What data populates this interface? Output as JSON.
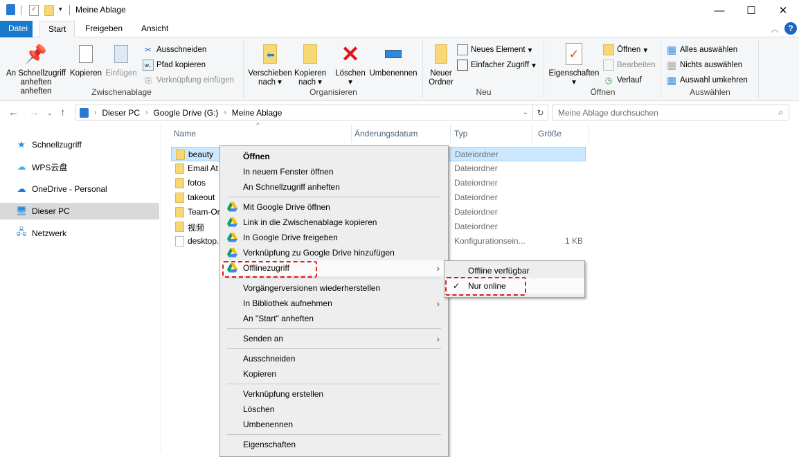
{
  "window": {
    "title": "Meine Ablage",
    "minimize": "—",
    "maximize": "☐",
    "close": "✕"
  },
  "tabs": [
    {
      "label": "Datei"
    },
    {
      "label": "Start"
    },
    {
      "label": "Freigeben"
    },
    {
      "label": "Ansicht"
    }
  ],
  "ribbon": {
    "zwischenablage": {
      "label": "Zwischenablage",
      "pin": "An Schnellzugriff anheften",
      "copy": "Kopieren",
      "paste": "Einfügen",
      "cut": "Ausschneiden",
      "copy_path": "Pfad kopieren",
      "paste_link": "Verknüpfung einfügen"
    },
    "organisieren": {
      "label": "Organisieren",
      "move_l1": "Verschieben",
      "move_l2": "nach",
      "copyto_l1": "Kopieren",
      "copyto_l2": "nach",
      "delete": "Löschen",
      "rename": "Umbenennen"
    },
    "neu": {
      "label": "Neu",
      "new_folder_l1": "Neuer",
      "new_folder_l2": "Ordner",
      "new_item": "Neues Element",
      "easy_access": "Einfacher Zugriff"
    },
    "oeffnen": {
      "label": "Öffnen",
      "properties": "Eigenschaften",
      "open": "Öffnen",
      "edit": "Bearbeiten",
      "history": "Verlauf"
    },
    "auswaehlen": {
      "label": "Auswählen",
      "select_all": "Alles auswählen",
      "select_none": "Nichts auswählen",
      "invert": "Auswahl umkehren"
    }
  },
  "address": {
    "path": [
      "Dieser PC",
      "Google Drive (G:)",
      "Meine Ablage"
    ],
    "search_placeholder": "Meine Ablage durchsuchen"
  },
  "nav": [
    {
      "label": "Schnellzugriff"
    },
    {
      "label": "WPS云盘"
    },
    {
      "label": "OneDrive - Personal"
    },
    {
      "label": "Dieser PC"
    },
    {
      "label": "Netzwerk"
    }
  ],
  "columns": {
    "name": "Name",
    "date": "Änderungsdatum",
    "type": "Typ",
    "size": "Größe"
  },
  "files": [
    {
      "name": "beauty",
      "type": "Dateiordner",
      "size": ""
    },
    {
      "name": "Email At",
      "type": "Dateiordner",
      "size": ""
    },
    {
      "name": "fotos",
      "type": "Dateiordner",
      "size": ""
    },
    {
      "name": "takeout",
      "type": "Dateiordner",
      "size": ""
    },
    {
      "name": "Team-Or",
      "type": "Dateiordner",
      "size": ""
    },
    {
      "name": "视频",
      "type": "Dateiordner",
      "size": ""
    },
    {
      "name": "desktop.",
      "type": "Konfigurationsein...",
      "size": "1 KB"
    }
  ],
  "context_menu": {
    "open": "Öffnen",
    "open_new_window": "In neuem Fenster öffnen",
    "pin_quick": "An Schnellzugriff anheften",
    "gd_open": "Mit Google Drive öffnen",
    "gd_link": "Link in die Zwischenablage kopieren",
    "gd_share": "In Google Drive freigeben",
    "gd_shortcut": "Verknüpfung zu Google Drive hinzufügen",
    "gd_offline": "Offlinezugriff",
    "restore": "Vorgängerversionen wiederherstellen",
    "library": "In Bibliothek aufnehmen",
    "pin_start": "An \"Start\" anheften",
    "send_to": "Senden an",
    "cut": "Ausschneiden",
    "copy": "Kopieren",
    "create_link": "Verknüpfung erstellen",
    "delete": "Löschen",
    "rename": "Umbenennen",
    "properties": "Eigenschaften"
  },
  "submenu": {
    "available_offline": "Offline verfügbar",
    "online_only": "Nur online",
    "checked": "online_only"
  },
  "colors": {
    "accent": "#1979ca",
    "selection": "#cce8ff",
    "highlight_box": "#e01b1b"
  }
}
